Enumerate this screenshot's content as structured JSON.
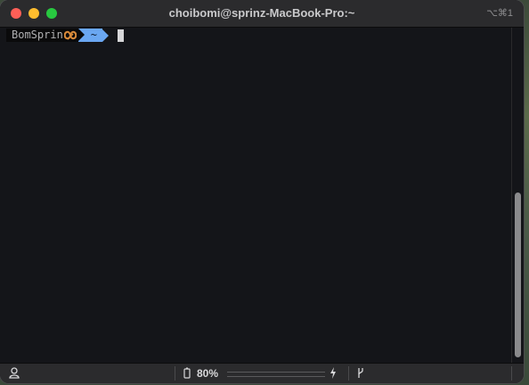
{
  "window": {
    "title": "choibomi@sprinz-MacBook-Pro:~",
    "shortcut": "⌥⌘1"
  },
  "prompt": {
    "user_segment": "BomSprin",
    "user_icon": "pretzel-icon",
    "dir_segment": "~",
    "dir_color": "#6aa7f2"
  },
  "scrollbar": {
    "position_fraction": 0.5
  },
  "statusbar": {
    "user_icon": "person-icon",
    "battery_icon": "battery-icon",
    "battery_percent": "80%",
    "battery_level": 0.8,
    "power_icon": "bolt-icon",
    "git_icon": "git-branch-icon"
  },
  "colors": {
    "close": "#fe5f57",
    "minimize": "#febc2e",
    "maximize": "#28c840",
    "terminal_bg": "#141519"
  }
}
